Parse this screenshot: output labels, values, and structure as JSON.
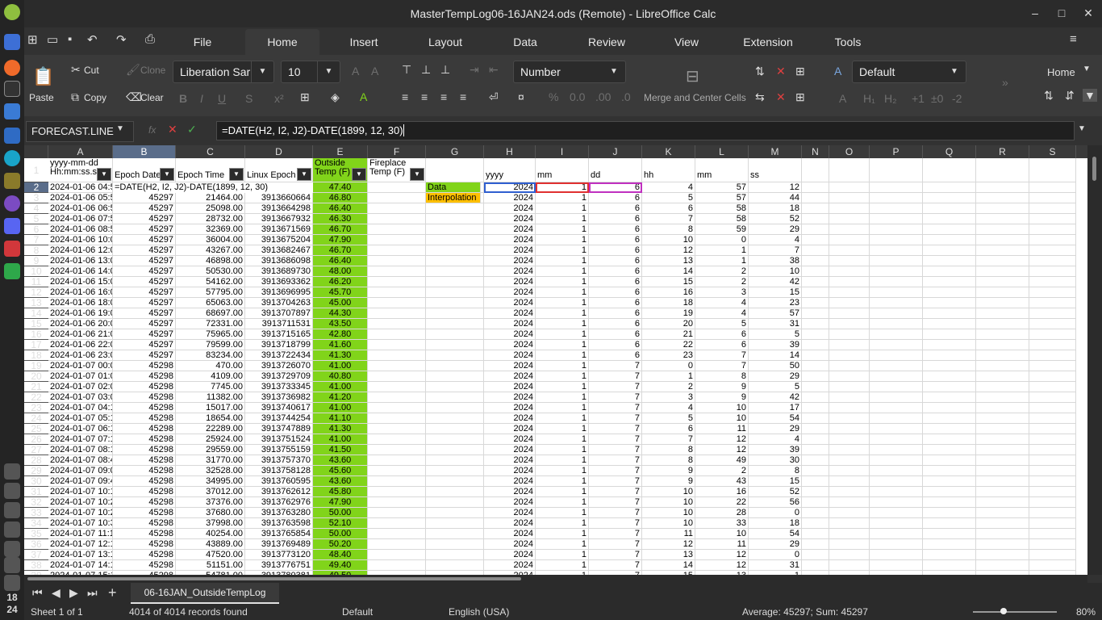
{
  "window": {
    "title": "MasterTempLog06-16JAN24.ods (Remote) - LibreOffice Calc"
  },
  "clock": "18\n24",
  "menu": {
    "tabs": [
      "File",
      "Home",
      "Insert",
      "Layout",
      "Data",
      "Review",
      "View",
      "Extension",
      "Tools"
    ],
    "active": "Home"
  },
  "ribbon": {
    "paste": "Paste",
    "cut": "Cut",
    "copy": "Copy",
    "clone": "Clone",
    "clear": "Clear",
    "font_name": "Liberation Sar",
    "font_size": "10",
    "number_format": "Number",
    "merge": "Merge and Center Cells",
    "style": "Default",
    "home_label": "Home"
  },
  "formula_bar": {
    "name_box": "FORECAST.LINE",
    "formula": "=DATE(H2, I2, J2)-DATE(1899, 12, 30)"
  },
  "columns": [
    "A",
    "B",
    "C",
    "D",
    "E",
    "F",
    "G",
    "H",
    "I",
    "J",
    "K",
    "L",
    "M",
    "N",
    "O",
    "P",
    "Q",
    "R",
    "S"
  ],
  "headers": {
    "A": "yyyy-mm-dd\nHh:mm:ss.s",
    "B": "Epoch Date",
    "C": "Epoch Time",
    "D": "Linux Epoch",
    "E": "Outside\nTemp (F)",
    "F": "Fireplace\nTemp (F)",
    "H": "yyyy",
    "I": "mm",
    "J": "dd",
    "K": "hh",
    "L": "mm",
    "M": "ss"
  },
  "labels": {
    "data": "Data",
    "interpolation": "Interpolation"
  },
  "b2_formula": "=DATE(H2, I2, J2)-DATE(1899, 12, 30)",
  "rows": [
    [
      "2024-01-06 04:57:12",
      "",
      "",
      "",
      "47.40",
      "2024",
      "1",
      "6",
      "4",
      "57",
      "12"
    ],
    [
      "2024-01-06 05:57:44",
      "45297",
      "21464.00",
      "3913660664",
      "46.80",
      "2024",
      "1",
      "6",
      "5",
      "57",
      "44"
    ],
    [
      "2024-01-06 06:58:18",
      "45297",
      "25098.00",
      "3913664298",
      "46.40",
      "2024",
      "1",
      "6",
      "6",
      "58",
      "18"
    ],
    [
      "2024-01-06 07:58:52",
      "45297",
      "28732.00",
      "3913667932",
      "46.30",
      "2024",
      "1",
      "6",
      "7",
      "58",
      "52"
    ],
    [
      "2024-01-06 08:59:29",
      "45297",
      "32369.00",
      "3913671569",
      "46.70",
      "2024",
      "1",
      "6",
      "8",
      "59",
      "29"
    ],
    [
      "2024-01-06 10:00:04",
      "45297",
      "36004.00",
      "3913675204",
      "47.90",
      "2024",
      "1",
      "6",
      "10",
      "0",
      "4"
    ],
    [
      "2024-01-06 12:01:07",
      "45297",
      "43267.00",
      "3913682467",
      "46.70",
      "2024",
      "1",
      "6",
      "12",
      "1",
      "7"
    ],
    [
      "2024-01-06 13:01:38",
      "45297",
      "46898.00",
      "3913686098",
      "46.40",
      "2024",
      "1",
      "6",
      "13",
      "1",
      "38"
    ],
    [
      "2024-01-06 14:02:10",
      "45297",
      "50530.00",
      "3913689730",
      "48.00",
      "2024",
      "1",
      "6",
      "14",
      "2",
      "10"
    ],
    [
      "2024-01-06 15:02:42",
      "45297",
      "54162.00",
      "3913693362",
      "46.20",
      "2024",
      "1",
      "6",
      "15",
      "2",
      "42"
    ],
    [
      "2024-01-06 16:03:15",
      "45297",
      "57795.00",
      "3913696995",
      "45.70",
      "2024",
      "1",
      "6",
      "16",
      "3",
      "15"
    ],
    [
      "2024-01-06 18:04:23",
      "45297",
      "65063.00",
      "3913704263",
      "45.00",
      "2024",
      "1",
      "6",
      "18",
      "4",
      "23"
    ],
    [
      "2024-01-06 19:04:57",
      "45297",
      "68697.00",
      "3913707897",
      "44.30",
      "2024",
      "1",
      "6",
      "19",
      "4",
      "57"
    ],
    [
      "2024-01-06 20:05:31",
      "45297",
      "72331.00",
      "3913711531",
      "43.50",
      "2024",
      "1",
      "6",
      "20",
      "5",
      "31"
    ],
    [
      "2024-01-06 21:06:05",
      "45297",
      "75965.00",
      "3913715165",
      "42.80",
      "2024",
      "1",
      "6",
      "21",
      "6",
      "5"
    ],
    [
      "2024-01-06 22:06:39",
      "45297",
      "79599.00",
      "3913718799",
      "41.60",
      "2024",
      "1",
      "6",
      "22",
      "6",
      "39"
    ],
    [
      "2024-01-06 23:07:14",
      "45297",
      "83234.00",
      "3913722434",
      "41.30",
      "2024",
      "1",
      "6",
      "23",
      "7",
      "14"
    ],
    [
      "2024-01-07 00:07:50",
      "45298",
      "470.00",
      "3913726070",
      "41.00",
      "2024",
      "1",
      "7",
      "0",
      "7",
      "50"
    ],
    [
      "2024-01-07 01:08:29",
      "45298",
      "4109.00",
      "3913729709",
      "40.80",
      "2024",
      "1",
      "7",
      "1",
      "8",
      "29"
    ],
    [
      "2024-01-07 02:09:05",
      "45298",
      "7745.00",
      "3913733345",
      "41.00",
      "2024",
      "1",
      "7",
      "2",
      "9",
      "5"
    ],
    [
      "2024-01-07 03:09:42",
      "45298",
      "11382.00",
      "3913736982",
      "41.20",
      "2024",
      "1",
      "7",
      "3",
      "9",
      "42"
    ],
    [
      "2024-01-07 04:10:17",
      "45298",
      "15017.00",
      "3913740617",
      "41.00",
      "2024",
      "1",
      "7",
      "4",
      "10",
      "17"
    ],
    [
      "2024-01-07 05:10:54",
      "45298",
      "18654.00",
      "3913744254",
      "41.10",
      "2024",
      "1",
      "7",
      "5",
      "10",
      "54"
    ],
    [
      "2024-01-07 06:11:29",
      "45298",
      "22289.00",
      "3913747889",
      "41.30",
      "2024",
      "1",
      "7",
      "6",
      "11",
      "29"
    ],
    [
      "2024-01-07 07:12:04",
      "45298",
      "25924.00",
      "3913751524",
      "41.00",
      "2024",
      "1",
      "7",
      "7",
      "12",
      "4"
    ],
    [
      "2024-01-07 08:12:39",
      "45298",
      "29559.00",
      "3913755159",
      "41.50",
      "2024",
      "1",
      "7",
      "8",
      "12",
      "39"
    ],
    [
      "2024-01-07 08:49:30",
      "45298",
      "31770.00",
      "3913757370",
      "43.60",
      "2024",
      "1",
      "7",
      "8",
      "49",
      "30"
    ],
    [
      "2024-01-07 09:02:08",
      "45298",
      "32528.00",
      "3913758128",
      "45.60",
      "2024",
      "1",
      "7",
      "9",
      "2",
      "8"
    ],
    [
      "2024-01-07 09:43:15",
      "45298",
      "34995.00",
      "3913760595",
      "43.60",
      "2024",
      "1",
      "7",
      "9",
      "43",
      "15"
    ],
    [
      "2024-01-07 10:16:52",
      "45298",
      "37012.00",
      "3913762612",
      "45.80",
      "2024",
      "1",
      "7",
      "10",
      "16",
      "52"
    ],
    [
      "2024-01-07 10:22:56",
      "45298",
      "37376.00",
      "3913762976",
      "47.90",
      "2024",
      "1",
      "7",
      "10",
      "22",
      "56"
    ],
    [
      "2024-01-07 10:28:00",
      "45298",
      "37680.00",
      "3913763280",
      "50.00",
      "2024",
      "1",
      "7",
      "10",
      "28",
      "0"
    ],
    [
      "2024-01-07 10:33:18",
      "45298",
      "37998.00",
      "3913763598",
      "52.10",
      "2024",
      "1",
      "7",
      "10",
      "33",
      "18"
    ],
    [
      "2024-01-07 11:10:54",
      "45298",
      "40254.00",
      "3913765854",
      "50.00",
      "2024",
      "1",
      "7",
      "11",
      "10",
      "54"
    ],
    [
      "2024-01-07 12:11:29",
      "45298",
      "43889.00",
      "3913769489",
      "50.20",
      "2024",
      "1",
      "7",
      "12",
      "11",
      "29"
    ],
    [
      "2024-01-07 13:12:00",
      "45298",
      "47520.00",
      "3913773120",
      "48.40",
      "2024",
      "1",
      "7",
      "13",
      "12",
      "0"
    ],
    [
      "2024-01-07 14:12:31",
      "45298",
      "51151.00",
      "3913776751",
      "49.40",
      "2024",
      "1",
      "7",
      "14",
      "12",
      "31"
    ],
    [
      "2024-01-07 15:13:01",
      "45298",
      "54781.00",
      "3913780381",
      "49.50",
      "2024",
      "1",
      "7",
      "15",
      "13",
      "1"
    ]
  ],
  "sheet_tab": "06-16JAN_OutsideTempLog",
  "status": {
    "sheet": "Sheet 1 of 1",
    "records": "4014 of 4014 records found",
    "style": "Default",
    "language": "English (USA)",
    "summary": "Average: 45297; Sum: 45297",
    "zoom": "80%"
  },
  "colors": {
    "green": "#81d41a",
    "data_label": "#81d41a",
    "interp_label": "#ffbf00",
    "accent": "#5a6d8a"
  }
}
